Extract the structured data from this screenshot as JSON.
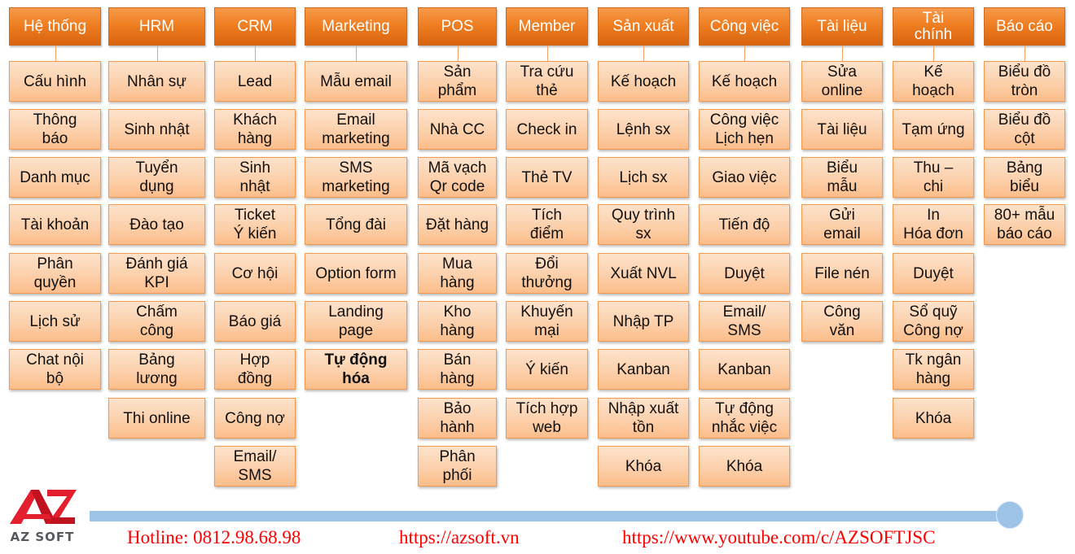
{
  "modules": [
    {
      "title": "Hệ thống",
      "items": [
        "Cấu hình",
        "Thông\nbáo",
        "Danh mục",
        "Tài khoản",
        "Phân\nquyền",
        "Lịch sử",
        "Chat nội\nbộ"
      ]
    },
    {
      "title": "HRM",
      "items": [
        "Nhân sự",
        "Sinh nhật",
        "Tuyển\ndụng",
        "Đào tạo",
        "Đánh giá\nKPI",
        "Chấm\ncông",
        "Bảng\nlương",
        "Thi online"
      ]
    },
    {
      "title": "CRM",
      "items": [
        "Lead",
        "Khách\nhàng",
        "Sinh\nnhật",
        "Ticket\nÝ kiến",
        "Cơ hội",
        "Báo giá",
        "Hợp\nđồng",
        "Công nợ",
        "Email/\nSMS"
      ]
    },
    {
      "title": "Marketing",
      "items": [
        "Mẫu email",
        "Email\nmarketing",
        "SMS\nmarketing",
        "Tổng đài",
        "Option form",
        "Landing\npage",
        "Tự động\nhóa"
      ],
      "bold_item_index": 6
    },
    {
      "title": "POS",
      "items": [
        "Sản\nphẩm",
        "Nhà CC",
        "Mã vạch\nQr code",
        "Đặt hàng",
        "Mua\nhàng",
        "Kho\nhàng",
        "Bán\nhàng",
        "Bảo\nhành",
        "Phân\nphối"
      ]
    },
    {
      "title": "Member",
      "items": [
        "Tra cứu\nthẻ",
        "Check in",
        "Thẻ TV",
        "Tích\nđiểm",
        "Đổi\nthưởng",
        "Khuyến\nmại",
        "Ý kiến",
        "Tích hợp\nweb"
      ]
    },
    {
      "title": "Sản xuất",
      "items": [
        "Kế hoạch",
        "Lệnh sx",
        "Lịch sx",
        "Quy trình\nsx",
        "Xuất NVL",
        "Nhập TP",
        "Kanban",
        "Nhập xuất\ntồn",
        "Khóa"
      ]
    },
    {
      "title": "Công việc",
      "items": [
        "Kế hoạch",
        "Công việc\nLịch hẹn",
        "Giao việc",
        "Tiến độ",
        "Duyệt",
        "Email/\nSMS",
        "Kanban",
        "Tự động\nnhắc việc",
        "Khóa"
      ]
    },
    {
      "title": "Tài liệu",
      "items": [
        "Sửa\nonline",
        "Tài liệu",
        "Biểu\nmẫu",
        "Gửi\nemail",
        "File nén",
        "Công\nvăn"
      ]
    },
    {
      "title": "Tài\nchính",
      "items": [
        "Kế\nhoạch",
        "Tạm ứng",
        "Thu –\nchi",
        "In\nHóa đơn",
        "Duyệt",
        "Sổ quỹ\nCông nợ",
        "Tk ngân\nhàng",
        "Khóa"
      ]
    },
    {
      "title": "Báo cáo",
      "items": [
        "Biểu đồ\ntròn",
        "Biểu đồ\ncột",
        "Bảng\nbiểu",
        "80+ mẫu\nbáo cáo"
      ]
    }
  ],
  "footer": {
    "logo_text": "AZ SOFT",
    "hotline": "Hotline: 0812.98.68.98",
    "website": "https://azsoft.vn",
    "youtube": "https://www.youtube.com/c/AZSOFTJSC"
  },
  "colors": {
    "header_orange": "#ef7f22",
    "item_peach": "#fcd0ab",
    "item_border": "#f39a4e",
    "bar_blue": "#9dc3e6",
    "logo_red": "#e31e2d",
    "footer_red": "#ff0000"
  }
}
